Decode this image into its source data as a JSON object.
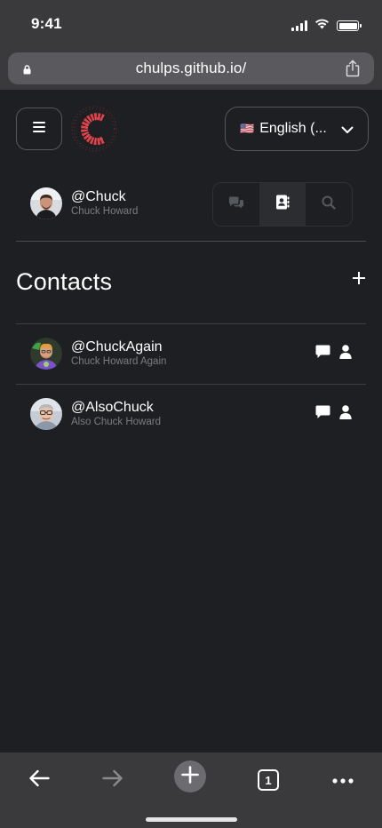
{
  "status": {
    "time": "9:41"
  },
  "browser": {
    "url": "chulps.github.io/"
  },
  "header": {
    "language_label": "English (...",
    "language_flag": "🇺🇸"
  },
  "current_user": {
    "handle": "@Chuck",
    "name": "Chuck Howard"
  },
  "tabs": [
    {
      "icon": "chats-icon",
      "active": false
    },
    {
      "icon": "contact-book-icon",
      "active": true
    },
    {
      "icon": "search-icon",
      "active": false
    }
  ],
  "contacts": {
    "title": "Contacts",
    "items": [
      {
        "handle": "@ChuckAgain",
        "name": "Chuck Howard Again"
      },
      {
        "handle": "@AlsoChuck",
        "name": "Also Chuck Howard"
      }
    ]
  },
  "colors": {
    "background": "#1e1f22",
    "chrome": "#3a3a3c",
    "logo_red": "#e0404a",
    "muted_text": "#7a7c80"
  }
}
